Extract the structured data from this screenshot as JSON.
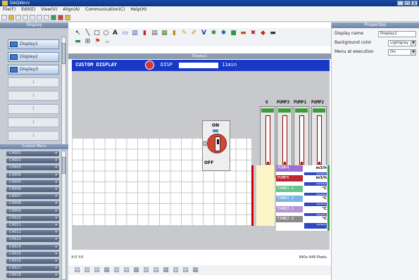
{
  "window": {
    "title": "DAQWorx",
    "controls": [
      "_",
      "□",
      "X"
    ]
  },
  "menu": [
    "File(F)",
    "Edit(E)",
    "View(V)",
    "Align(A)",
    "Communication(C)",
    "Help(H)"
  ],
  "left_panel": {
    "header": "Display",
    "displays": [
      "Display1",
      "Display2",
      "Display3"
    ],
    "empty_slots": [
      "1",
      "1",
      "1",
      "1",
      "1"
    ],
    "tools_header": "Custom Menu",
    "tool_items": [
      "CH001",
      "CH002",
      "CH003",
      "CH004",
      "CH005",
      "CH006",
      "CH007",
      "CH008",
      "CH009",
      "CH010",
      "CH011",
      "CH012",
      "CH013",
      "CH014",
      "CH015",
      "CH016",
      "CH017",
      "CH018"
    ]
  },
  "canvas": {
    "sheet_title": "Display1",
    "header": {
      "title": "CUSTOM DISPLAY",
      "disp_label": "DISP",
      "interval": "11min"
    },
    "gauges": [
      {
        "label": "6"
      },
      {
        "label": "PUMP3"
      },
      {
        "label": "PUMP1"
      },
      {
        "label": "PUMP2"
      }
    ],
    "switch": {
      "on_label": "ON",
      "off_label": "OFF"
    },
    "values": [
      {
        "name": "PUMP4",
        "unit": "m3/h",
        "value": "*****",
        "color": "#9b6fcf"
      },
      {
        "name": "PUMP5",
        "unit": "m3/h",
        "value": "*****",
        "color": "#c0272d"
      },
      {
        "name": "TANK1-1",
        "unit": "°C",
        "value": "*****",
        "color": "#65c38a"
      },
      {
        "name": "TANK1-2",
        "unit": "°C",
        "value": "*****",
        "color": "#79b4e6"
      },
      {
        "name": "TANK2-1",
        "unit": "°C",
        "value": "*****",
        "color": "#b594d6"
      },
      {
        "name": "TANK2-2",
        "unit": "°C",
        "value": "*****",
        "color": "#8a8a8a"
      }
    ],
    "status_left": "X:0  Y:0",
    "status_right": "640x 449 Pixels"
  },
  "right_panel": {
    "header": "Properties",
    "rows": [
      {
        "label": "Display name",
        "value": "Display1"
      },
      {
        "label": "Background color",
        "value": "Lightgray"
      },
      {
        "label": "Menu at execution",
        "value": "On"
      }
    ]
  }
}
